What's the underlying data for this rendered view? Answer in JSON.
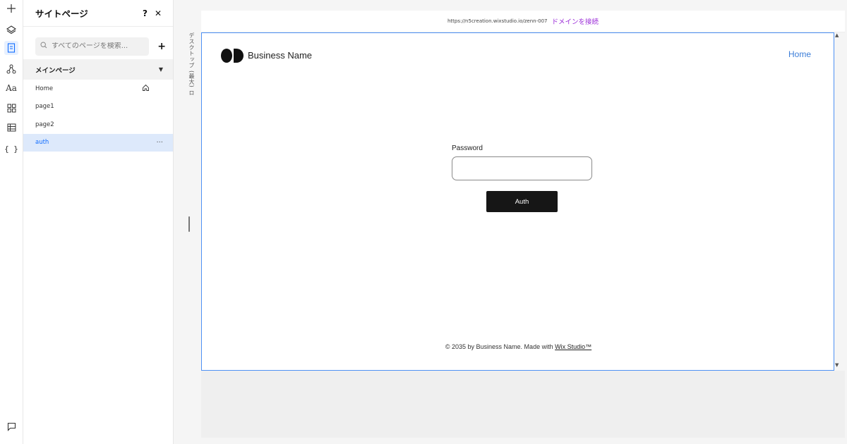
{
  "panel": {
    "title": "サイトページ",
    "help_icon": "?",
    "close_icon": "✕",
    "search_placeholder": "すべてのページを検索...",
    "add_icon": "+",
    "section_label": "メインページ",
    "section_caret": "▼",
    "pages": [
      {
        "label": "Home",
        "icon": "home-icon"
      },
      {
        "label": "page1"
      },
      {
        "label": "page2"
      },
      {
        "label": "auth",
        "selected": true,
        "more": "···"
      }
    ]
  },
  "rail_icons": [
    "add-icon",
    "layers-icon",
    "pages-icon",
    "sitemap-icon",
    "text-theme-icon",
    "apps-icon",
    "cms-icon",
    "code-icon",
    "chat-icon"
  ],
  "viewport_label": "デスクトップ (最大) ロ",
  "urlbar": {
    "url": "https://n5creation.wixstudio.io/zenn-007",
    "connect_domain": "ドメインを接続"
  },
  "site": {
    "business_name": "Business Name",
    "nav_home": "Home",
    "password_label": "Password",
    "auth_button": "Auth",
    "footer_text": "© 2035 by Business Name. Made with ",
    "footer_link": "Wix Studio™"
  },
  "colors": {
    "accent": "#116dff",
    "connect": "#9b2cd8",
    "selection_border": "#4e91f4",
    "button": "#161616"
  }
}
